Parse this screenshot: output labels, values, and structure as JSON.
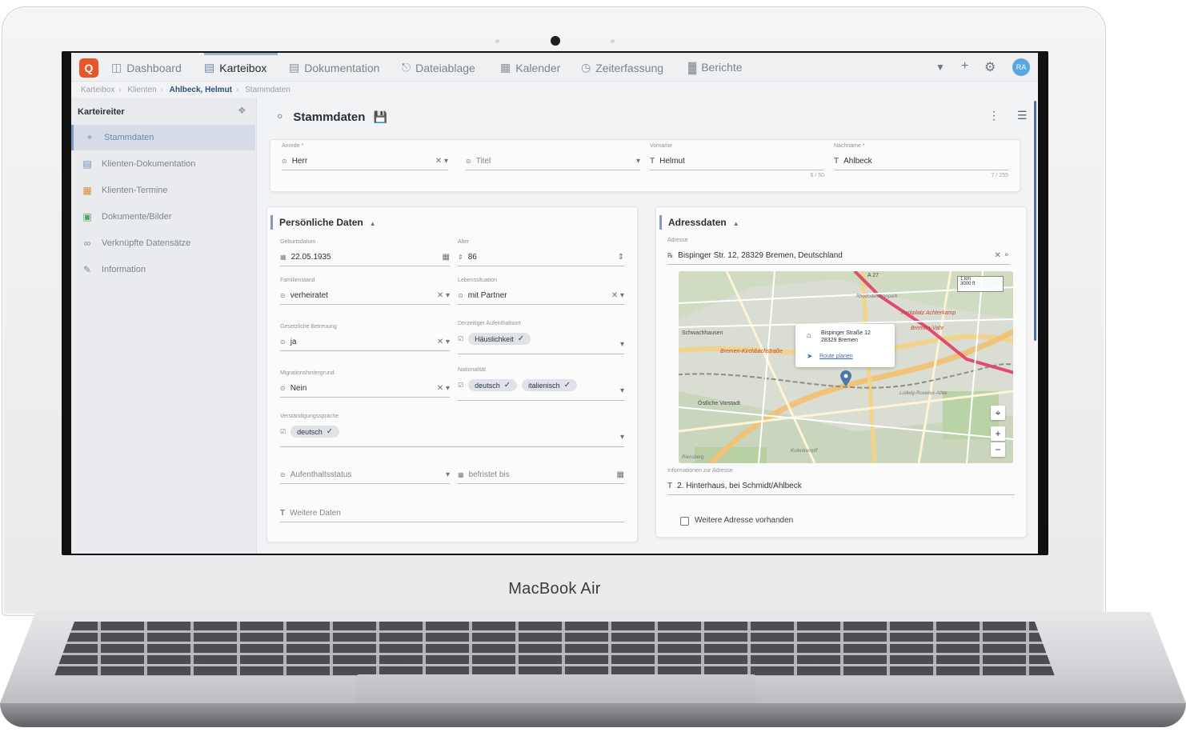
{
  "device": {
    "brand": "MacBook Air"
  },
  "nav": {
    "logo": "Q",
    "items": [
      {
        "label": "Dashboard",
        "icon": "dashboard-icon"
      },
      {
        "label": "Karteibox",
        "icon": "card-box-icon",
        "active": true
      },
      {
        "label": "Dokumentation",
        "icon": "document-icon"
      },
      {
        "label": "Dateiablage",
        "icon": "file-storage-icon"
      },
      {
        "label": "Kalender",
        "icon": "calendar-icon"
      },
      {
        "label": "Zeiterfassung",
        "icon": "clock-icon"
      },
      {
        "label": "Berichte",
        "icon": "chart-icon"
      }
    ],
    "user_initials": "RA"
  },
  "breadcrumb": {
    "items": [
      "Karteibox",
      "Klienten",
      "Ahlbeck, Helmut",
      "Stammdaten"
    ]
  },
  "sidebar": {
    "title": "Karteireiter",
    "items": [
      {
        "label": "Stammdaten",
        "icon": "person-icon",
        "active": true
      },
      {
        "label": "Klienten-Dokumentation",
        "icon": "document-icon"
      },
      {
        "label": "Klienten-Termine",
        "icon": "calendar-icon"
      },
      {
        "label": "Dokumente/Bilder",
        "icon": "image-icon"
      },
      {
        "label": "Verknüpfte Datensätze",
        "icon": "link-icon"
      },
      {
        "label": "Information",
        "icon": "pencil-icon"
      }
    ]
  },
  "page": {
    "title": "Stammdaten"
  },
  "name_fields": {
    "anrede": {
      "label": "Anrede *",
      "value": "Herr"
    },
    "titel": {
      "placeholder": "Titel"
    },
    "vorname": {
      "label": "Vorname",
      "value": "Helmut",
      "counter": "6 / 50"
    },
    "nachname": {
      "label": "Nachname *",
      "value": "Ahlbeck",
      "counter": "7 / 255"
    }
  },
  "personal": {
    "title": "Persönliche Daten",
    "geburtsdatum": {
      "label": "Geburtsdatum",
      "value": "22.05.1935"
    },
    "alter": {
      "label": "Alter",
      "value": "86"
    },
    "familienstand": {
      "label": "Familienstand",
      "value": "verheiratet"
    },
    "lebenssituation": {
      "label": "Lebenssituation",
      "value": "mit Partner"
    },
    "betreuung": {
      "label": "Gesetzliche Betreuung",
      "value": "ja"
    },
    "aufenthaltsort": {
      "label": "Derzeitiger Aufenthaltsort",
      "chips": [
        "Häuslichkeit"
      ]
    },
    "migration": {
      "label": "Migrationshintergrund",
      "value": "Nein"
    },
    "nationalitaet": {
      "label": "Nationalität",
      "chips": [
        "deutsch",
        "italienisch"
      ]
    },
    "sprache": {
      "label": "Verständigungssprache",
      "chips": [
        "deutsch"
      ]
    },
    "aufenthaltsstatus": {
      "placeholder": "Aufenthaltsstatus"
    },
    "befristet": {
      "placeholder": "befristet bis"
    },
    "weitere": {
      "placeholder": "Weitere Daten"
    }
  },
  "address": {
    "title": "Adressdaten",
    "adresse": {
      "label": "Adresse",
      "value": "Bispinger Str. 12, 28329 Bremen, Deutschland"
    },
    "map": {
      "popup_line1": "Bispinger Straße 12",
      "popup_line2": "28329 Bremen",
      "popup_link": "Route planen",
      "scale_km": "1 km",
      "scale_ft": "3000 ft",
      "labels": [
        "Schwachhausen",
        "Östliche Vorstadt",
        "Bremen-Kirchbachstraße",
        "Parkplatz Achterkamp",
        "Bremen-Vahr",
        "A 27",
        "Ludwig-Roselius-Allee",
        "Rhododendronpark",
        "Riensberg",
        "Kulenkampff"
      ]
    },
    "info": {
      "label": "Informationen zur Adresse",
      "value": "2. Hinterhaus, bei Schmidt/Ahlbeck"
    },
    "weitere": "Weitere Adresse vorhanden"
  }
}
